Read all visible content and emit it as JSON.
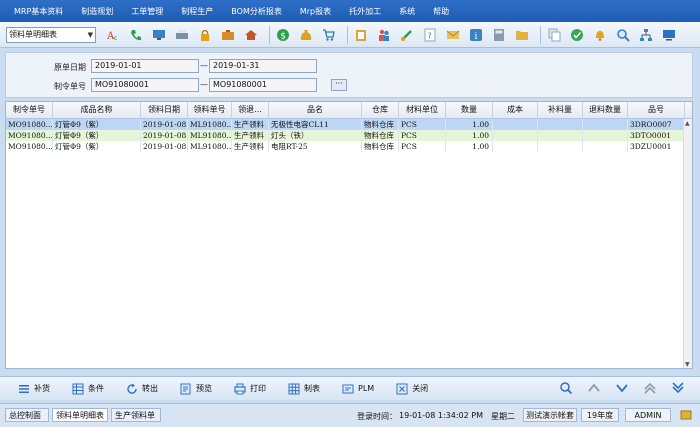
{
  "menu": [
    "MRP基本资料",
    "制造规划",
    "工单管理",
    "制程生产",
    "BOM分析报表",
    "Mrp报表",
    "托外加工",
    "系统",
    "帮助"
  ],
  "toolbar": {
    "report_selector_value": "领料单明细表"
  },
  "filter": {
    "date_label": "原单日期",
    "date_from": "2019-01-01",
    "date_to": "2019-01-31",
    "order_label": "制令单号",
    "order_from": "MO91080001",
    "order_to": "MO91080001",
    "range_sep": "—",
    "more_button": "···"
  },
  "table": {
    "headers": [
      "制令单号",
      "成品名称",
      "领料日期",
      "领料单号",
      "领退...",
      "品名",
      "仓库",
      "材料单位",
      "数量",
      "成本",
      "补料量",
      "退料数量",
      "品号"
    ],
    "rows": [
      [
        "MO91080...",
        "灯管Φ9（紫）",
        "2019-01-08",
        "ML91080...",
        "生产领料",
        "无极性电容CL11",
        "物料仓库",
        "PCS",
        "1.00",
        "",
        "",
        "",
        "3DRO0007"
      ],
      [
        "MO91080...",
        "灯管Φ9（紫）",
        "2019-01-08",
        "ML91080...",
        "生产领料",
        "灯头（铁）",
        "物料仓库",
        "PCS",
        "1.00",
        "",
        "",
        "",
        "3DTO0001"
      ],
      [
        "MO91080...",
        "灯管Φ9（紫）",
        "2019-01-08",
        "ML91080...",
        "生产领料",
        "电阻RT-25",
        "物料仓库",
        "PCS",
        "1.00",
        "",
        "",
        "",
        "3DZU0001"
      ]
    ]
  },
  "actions": [
    "补货",
    "条件",
    "转出",
    "预览",
    "打印",
    "制表",
    "PLM",
    "关闭"
  ],
  "status": {
    "tabs": [
      "总控制面",
      "领料单明细表",
      "生产领料单"
    ],
    "login_label": "登录时间：",
    "login_time": "19-01-08 1:34:02 PM",
    "weekday": "星期二",
    "company": "测试演示帐套",
    "year": "19年度",
    "user": "ADMIN"
  },
  "colors": {
    "menubar": "#1f5cb3",
    "selected_row": "#bcd7f5",
    "alt_row": "#e6f5d8"
  }
}
